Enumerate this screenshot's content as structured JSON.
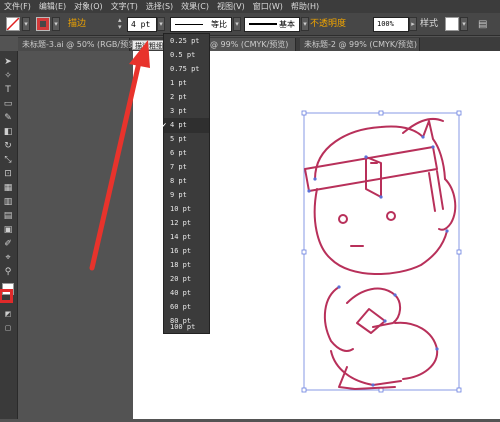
{
  "menu": [
    "文件(F)",
    "编辑(E)",
    "对象(O)",
    "文字(T)",
    "选择(S)",
    "效果(C)",
    "视图(V)",
    "窗口(W)",
    "帮助(H)"
  ],
  "control": {
    "stroke_label": "描边",
    "stroke_weight": "4 pt",
    "profile_label": "等比",
    "brush_label": "基本",
    "opacity_label": "不透明度",
    "opacity_value": "100%",
    "style_label": "样式"
  },
  "tabs": [
    "未标题-3.ai @ 50% (RGB/预览)",
    "@ 99% (CMYK/预览)",
    "未标题-2 @ 99% (CMYK/预览)"
  ],
  "tooltip": "描边粗细",
  "weights": [
    "0.25 pt",
    "0.5 pt",
    "0.75 pt",
    "1 pt",
    "2 pt",
    "3 pt",
    "4 pt",
    "5 pt",
    "6 pt",
    "7 pt",
    "8 pt",
    "9 pt",
    "10 pt",
    "12 pt",
    "14 pt",
    "16 pt",
    "18 pt",
    "20 pt",
    "40 pt",
    "60 pt",
    "80 pt",
    "100 pt"
  ],
  "selected_weight": "4 pt",
  "colors": {
    "accent": "#f0a400",
    "stroke": "#c0295a",
    "selection": "#5c6fd6",
    "arrow": "#e8332c"
  }
}
